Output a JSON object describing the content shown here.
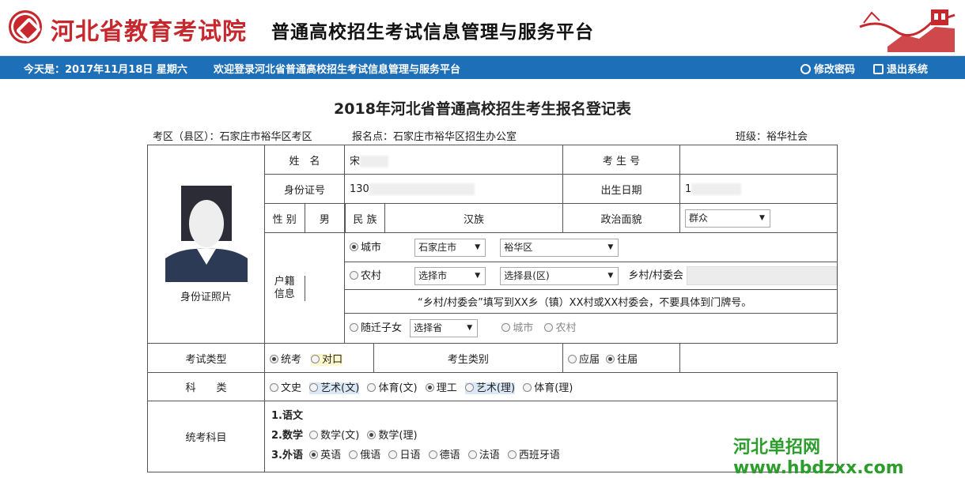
{
  "header": {
    "org_name": "河北省教育考试院",
    "platform_name": "普通高校招生考试信息管理与服务平台"
  },
  "topbar": {
    "date_text": "今天是：2017年11月18日 星期六",
    "welcome_text": "欢迎登录河北省普通高校招生考试信息管理与服务平台",
    "change_password": "修改密码",
    "logout": "退出系统"
  },
  "form": {
    "title": "2018年河北省普通高校招生考生报名登记表",
    "exam_area": "考区（县区）：石家庄市裕华区考区",
    "reg_point": "报名点：石家庄市裕华区招生办公室",
    "class": "班级：裕华社会",
    "photo_label": "身份证照片",
    "name_label": "姓　名",
    "name_value": "宋",
    "exam_no_label": "考 生 号",
    "id_label": "身份证号",
    "id_value": "130",
    "birth_label": "出生日期",
    "birth_value": "1",
    "gender_label": "性 别",
    "gender_value": "男",
    "ethnic_label": "民 族",
    "ethnic_value": "汉族",
    "political_label": "政治面貌",
    "political_value": "群众",
    "hukou_label": "户籍信息",
    "city_radio": "城市",
    "city_select": "石家庄市",
    "district_select": "裕华区",
    "rural_radio": "农村",
    "rural_city_select": "选择市",
    "rural_county_select": "选择县(区)",
    "village_label": "乡村/村委会",
    "village_note": "“乡村/村委会”填写到XX乡（镇）XX村或XX村委会，不要具体到门牌号。",
    "migrant_radio": "随迁子女",
    "province_select": "选择省",
    "migrant_city": "城市",
    "migrant_rural": "农村",
    "exam_type_label": "考试类型",
    "exam_type_unified": "统考",
    "exam_type_vocational": "对口",
    "candidate_type_label": "考生类别",
    "candidate_fresh": "应届",
    "candidate_past": "往届",
    "subject_label": "科　　类",
    "subjects": [
      "文史",
      "艺术(文)",
      "体育(文)",
      "理工",
      "艺术(理)",
      "体育(理)"
    ],
    "unified_subjects_label": "统考科目",
    "s1": "1.语文",
    "s2": "2.数学",
    "math_options": [
      "数学(文)",
      "数学(理)"
    ],
    "s3": "3.外语",
    "lang_options": [
      "英语",
      "俄语",
      "日语",
      "德语",
      "法语",
      "西班牙语"
    ]
  },
  "watermark": "河北单招网www.hbdzxx.com",
  "colors": {
    "brand_red": "#c7282d",
    "bar_blue": "#1d6fb7"
  }
}
